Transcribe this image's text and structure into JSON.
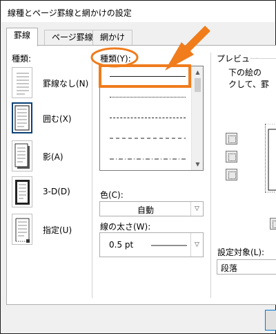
{
  "dialog": {
    "title": "線種とページ罫線と網かけの設定"
  },
  "tabs": [
    {
      "label": "罫線",
      "active": true
    },
    {
      "label": "ページ罫線",
      "active": false
    },
    {
      "label": "網かけ",
      "active": false
    }
  ],
  "settings": {
    "label": "種類:",
    "items": [
      {
        "label": "罫線なし(N)",
        "icon": "no-border-icon"
      },
      {
        "label": "囲む(X)",
        "icon": "box-border-icon",
        "selected": true
      },
      {
        "label": "影(A)",
        "icon": "shadow-border-icon"
      },
      {
        "label": "3-D(D)",
        "icon": "3d-border-icon"
      },
      {
        "label": "指定(U)",
        "icon": "custom-border-icon"
      }
    ]
  },
  "style": {
    "label": "種類(Y):",
    "options": [
      "solid",
      "dotted",
      "dash-small",
      "dashed",
      "dash-dot"
    ],
    "selected_index": 0
  },
  "color": {
    "label": "色(C):",
    "value": "自動"
  },
  "width": {
    "label": "線の太さ(W):",
    "value": "0.5 pt"
  },
  "preview": {
    "label": "プレビュー",
    "text_line1": "下の絵の",
    "text_line2": "クして、罫"
  },
  "apply_to": {
    "label": "設定対象(L):",
    "value": "段落"
  },
  "annotation": {
    "color": "#f07c1c"
  },
  "colors": {
    "selected_border": "#0a3f75",
    "focus_blue": "#0078d7"
  }
}
